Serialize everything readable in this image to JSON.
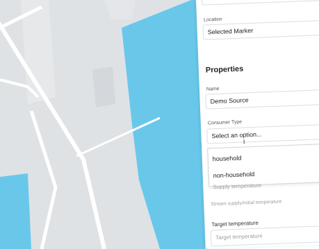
{
  "location": {
    "label": "Location",
    "value": "Selected Marker"
  },
  "properties": {
    "heading": "Properties",
    "name_label": "Name",
    "name_value": "Demo Source",
    "consumer_type_label": "Consumer Type",
    "consumer_type_placeholder": "Select an option...",
    "options": [
      "household",
      "non-household"
    ],
    "supply_placeholder": "Supply temperature",
    "stream_label": "Stream supply/initial temperature",
    "target_label": "Target temperature",
    "target_placeholder": "Target temperature"
  },
  "colors": {
    "water": "#69c8ea",
    "land": "#dfe2e5",
    "road": "#ffffff"
  }
}
